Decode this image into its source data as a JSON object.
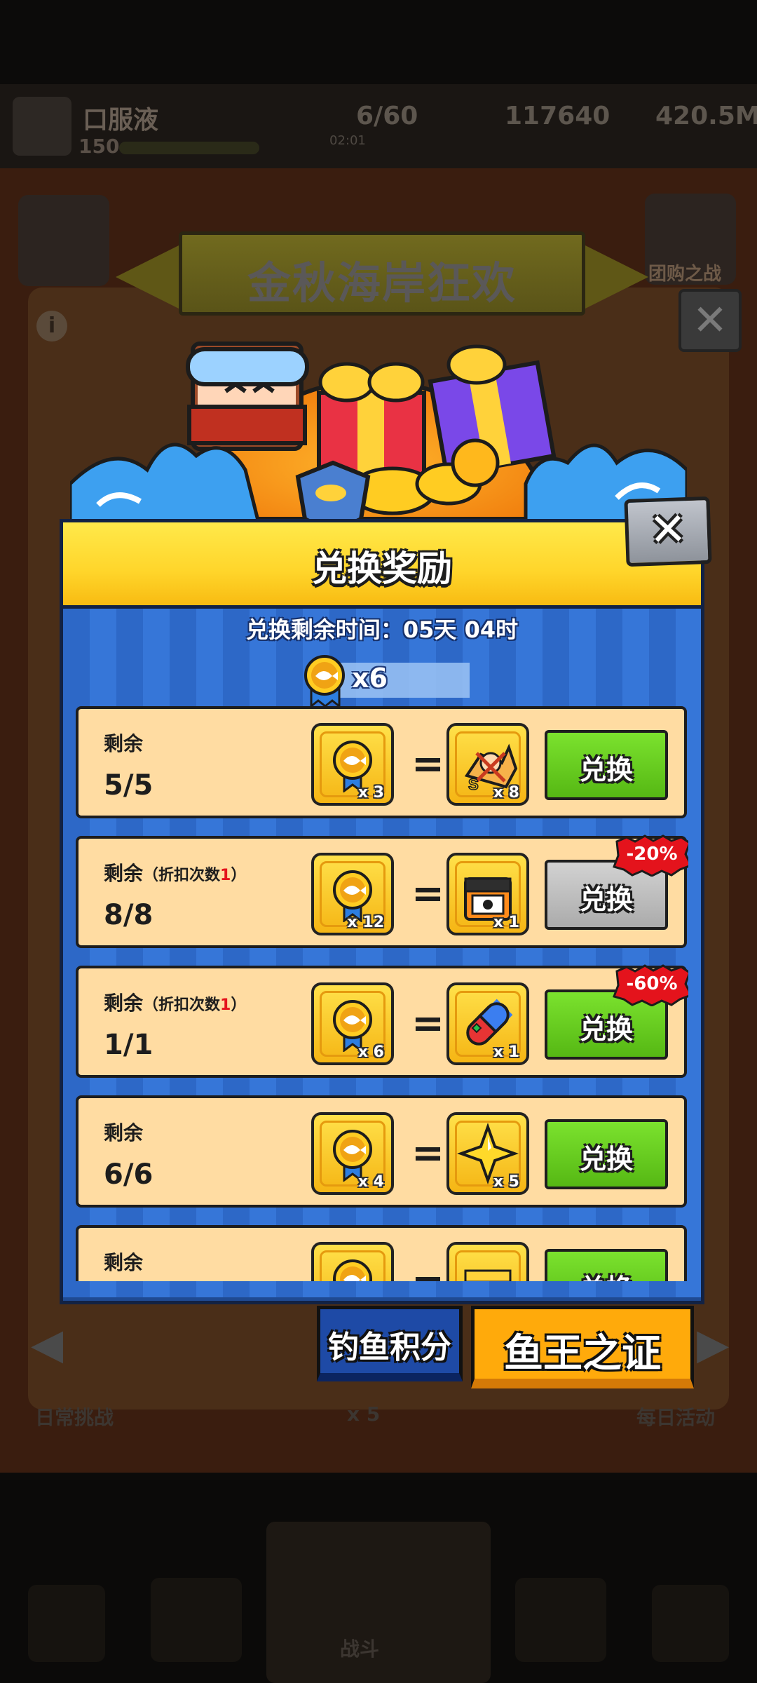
{
  "background": {
    "player_name": "口服液",
    "player_level": "150",
    "energy": "6/60",
    "energy_timer": "02:01",
    "coins": "117640",
    "gems": "420.5M",
    "banner_title": "金秋海岸狂欢",
    "side_label": "团购之战",
    "bottom_left": "日常挑战",
    "bottom_mid": "x 5",
    "bottom_right": "每日活动",
    "bottom_nav_center": "战斗"
  },
  "dialog": {
    "title": "兑换奖励",
    "timer": "兑换剩余时间：05天 04时",
    "balance": "x6",
    "colors": {
      "header": "#ffd52a",
      "body": "#2d68c7",
      "row": "#ffdca2",
      "button": "#66cc22",
      "button_disabled": "#bdbdbd",
      "discount": "#e4131c"
    },
    "rows": [
      {
        "label": "剩余",
        "note_prefix": "",
        "note_num": "",
        "note_suffix": "",
        "count": "5/5",
        "cost_qty": "x 3",
        "reward_icon": "fish-chart-icon",
        "reward_qty": "x 8",
        "button": "兑换",
        "enabled": true,
        "discount": ""
      },
      {
        "label": "剩余",
        "note_prefix": "（折扣次数",
        "note_num": "1",
        "note_suffix": "）",
        "count": "8/8",
        "cost_qty": "x 12",
        "reward_icon": "treasure-chest-icon",
        "reward_qty": "x 1",
        "button": "兑换",
        "enabled": false,
        "discount": "-20%"
      },
      {
        "label": "剩余",
        "note_prefix": "（折扣次数",
        "note_num": "1",
        "note_suffix": "）",
        "count": "1/1",
        "cost_qty": "x 6",
        "reward_icon": "capsule-pill-icon",
        "reward_qty": "x 1",
        "button": "兑换",
        "enabled": true,
        "discount": "-60%"
      },
      {
        "label": "剩余",
        "note_prefix": "",
        "note_num": "",
        "note_suffix": "",
        "count": "6/6",
        "cost_qty": "x 4",
        "reward_icon": "star-icon",
        "reward_qty": "x 5",
        "button": "兑换",
        "enabled": true,
        "discount": ""
      },
      {
        "label": "剩余",
        "note_prefix": "",
        "note_num": "",
        "note_suffix": "",
        "count": "",
        "cost_qty": "",
        "reward_icon": "gift-icon",
        "reward_qty": "",
        "button": "兑换",
        "enabled": true,
        "discount": ""
      }
    ]
  },
  "tabs": {
    "left": "钓鱼积分",
    "right": "鱼王之证",
    "active": "right"
  }
}
